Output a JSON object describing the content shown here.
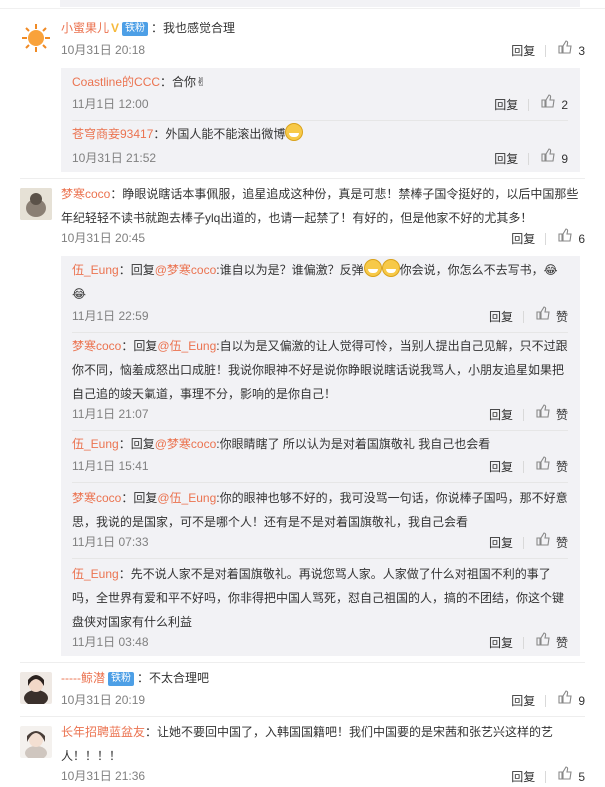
{
  "comments": [
    {
      "user": "小蜜果儿",
      "badge": "铁粉",
      "content": "：我也感觉合理",
      "time": "10月31日 20:18",
      "reply": "回复",
      "likes": "3",
      "replies": [
        {
          "user": "Coastline的CCC",
          "content": "：合你",
          "time": "11月1日 12:00",
          "reply": "回复",
          "likes": "2"
        },
        {
          "user": "苍穹商妾93417",
          "content": "：外国人能不能滚出微博",
          "time": "10月31日 21:52",
          "reply": "回复",
          "likes": "9"
        }
      ]
    },
    {
      "user": "梦寒coco",
      "content": "：睁眼说瞎话本事佩服，追星追成这种份，真是可悲！禁棒子国令挺好的，以后中国那些年纪轻轻不读书就跑去棒子ylq出道的，也请一起禁了！有好的，但是他家不好的尤其多！",
      "time": "10月31日 20:45",
      "reply": "回复",
      "likes": "6",
      "replies": [
        {
          "user": "伍_Eung",
          "pre": "：回复",
          "at": "@梦寒coco",
          "content": ":谁自以为是？谁偏激？反弹",
          "content2": "你会说，你怎么不去写书，",
          "time": "11月1日 22:59",
          "reply": "回复",
          "likes": "赞"
        },
        {
          "user": "梦寒coco",
          "pre": "：回复",
          "at": "@伍_Eung",
          "content": ":自以为是又偏激的让人觉得可怜，当别人提出自己见解，只不过跟你不同，恼羞成怒出口成脏！我说你眼神不好是说你睁眼说瞎话说我骂人，小朋友追星如果把自己追的竣天氭道，事理不分，影响的是你自己！",
          "time": "11月1日 21:07",
          "reply": "回复",
          "likes": "赞"
        },
        {
          "user": "伍_Eung",
          "pre": "：回复",
          "at": "@梦寒coco",
          "content": ":你眼睛瞎了 所以认为是对着国旗敬礼 我自己也会看",
          "time": "11月1日 15:41",
          "reply": "回复",
          "likes": "赞"
        },
        {
          "user": "梦寒coco",
          "pre": "：回复",
          "at": "@伍_Eung",
          "content": ":你的眼神也够不好的，我可没骂一句话，你说棒子国吗，那不好意思，我说的是国家，可不是哪个人！还有是不是对着国旗敬礼，我自己会看",
          "time": "11月1日 07:33",
          "reply": "回复",
          "likes": "赞"
        },
        {
          "user": "伍_Eung",
          "content": "：先不说人家不是对着国旗敬礼。再说您骂人家。人家做了什么对祖国不利的事了吗，全世界有爱和平不好吗，你非得把中国人骂死，怼自己祖国的人，搞的不团结，你这个键盘侠对国家有什么利益",
          "time": "11月1日 03:48",
          "reply": "回复",
          "likes": "赞"
        }
      ]
    },
    {
      "user": "-----鲸潜",
      "badge": "铁粉",
      "content": "：不太合理吧",
      "time": "10月31日 20:19",
      "reply": "回复",
      "likes": "9"
    },
    {
      "user": "长年招聘蓝盆友",
      "content": "：让她不要回中国了，入韩国国籍吧！我们中国要的是宋茜和张艺兴这样的艺人！！！！",
      "time": "10月31日 21:36",
      "reply": "回复",
      "likes": "5"
    }
  ]
}
